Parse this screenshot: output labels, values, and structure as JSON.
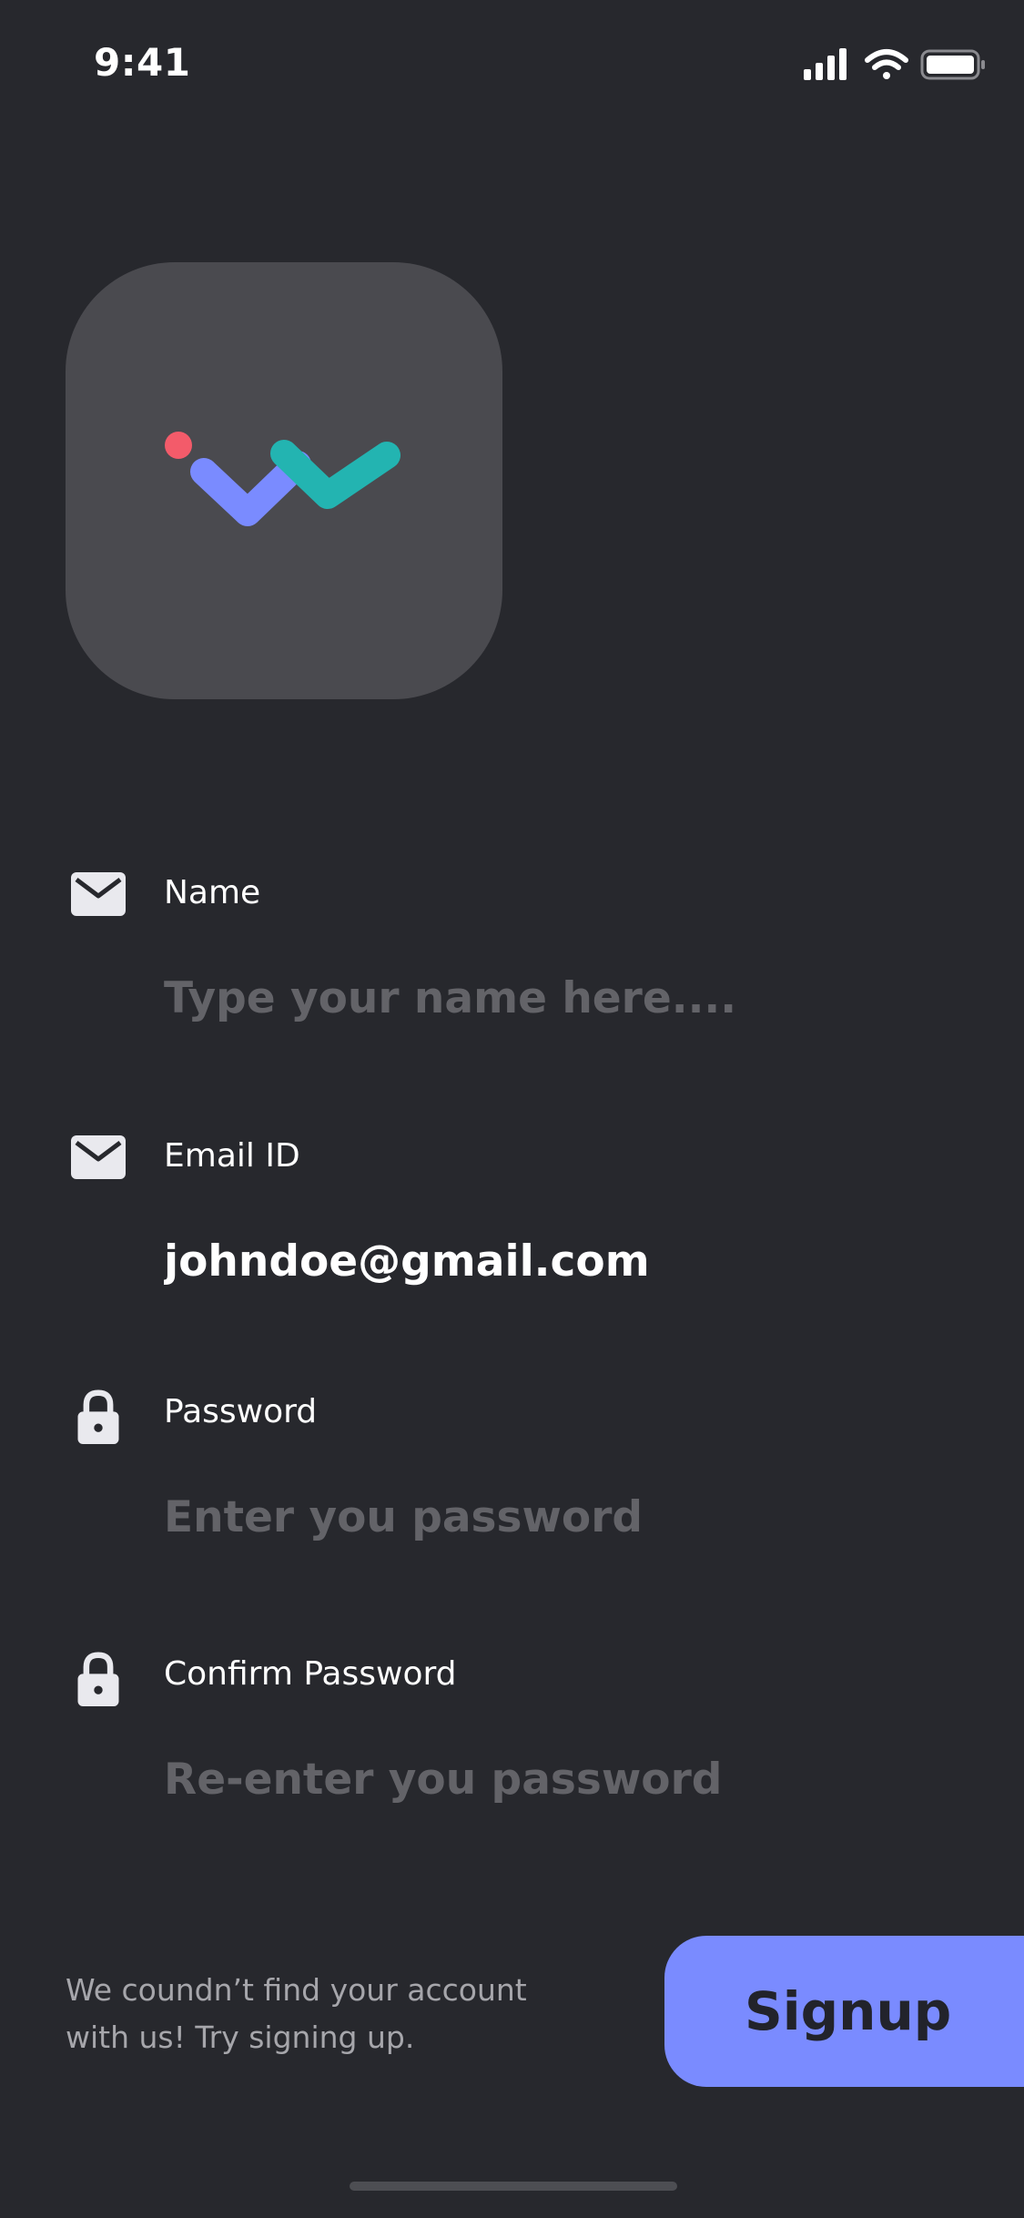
{
  "status_bar": {
    "time": "9:41",
    "icons": [
      "signal-icon",
      "wifi-icon",
      "battery-icon"
    ]
  },
  "logo": {
    "icon": "app-logo-icon",
    "colors": {
      "dot": "#f35b6a",
      "purple": "#7a8bff",
      "teal": "#23b4b1",
      "tile": "#4a4a4f"
    }
  },
  "form": {
    "name": {
      "icon": "mail-icon",
      "label": "Name",
      "value": "",
      "placeholder": "Type your name here...."
    },
    "email": {
      "icon": "mail-icon",
      "label": "Email ID",
      "value": "johndoe@gmail.com",
      "placeholder": ""
    },
    "password": {
      "icon": "lock-icon",
      "label": "Password",
      "value": "",
      "placeholder": "Enter you password"
    },
    "confirm_password": {
      "icon": "lock-icon",
      "label": "Confirm Password",
      "value": "",
      "placeholder": "Re-enter you password"
    }
  },
  "footer": {
    "message": "We coundn’t find your account with us! Try signing up.",
    "signup_label": "Signup"
  },
  "colors": {
    "background": "#27282d",
    "accent": "#7a8bff",
    "placeholder": "#636368"
  }
}
